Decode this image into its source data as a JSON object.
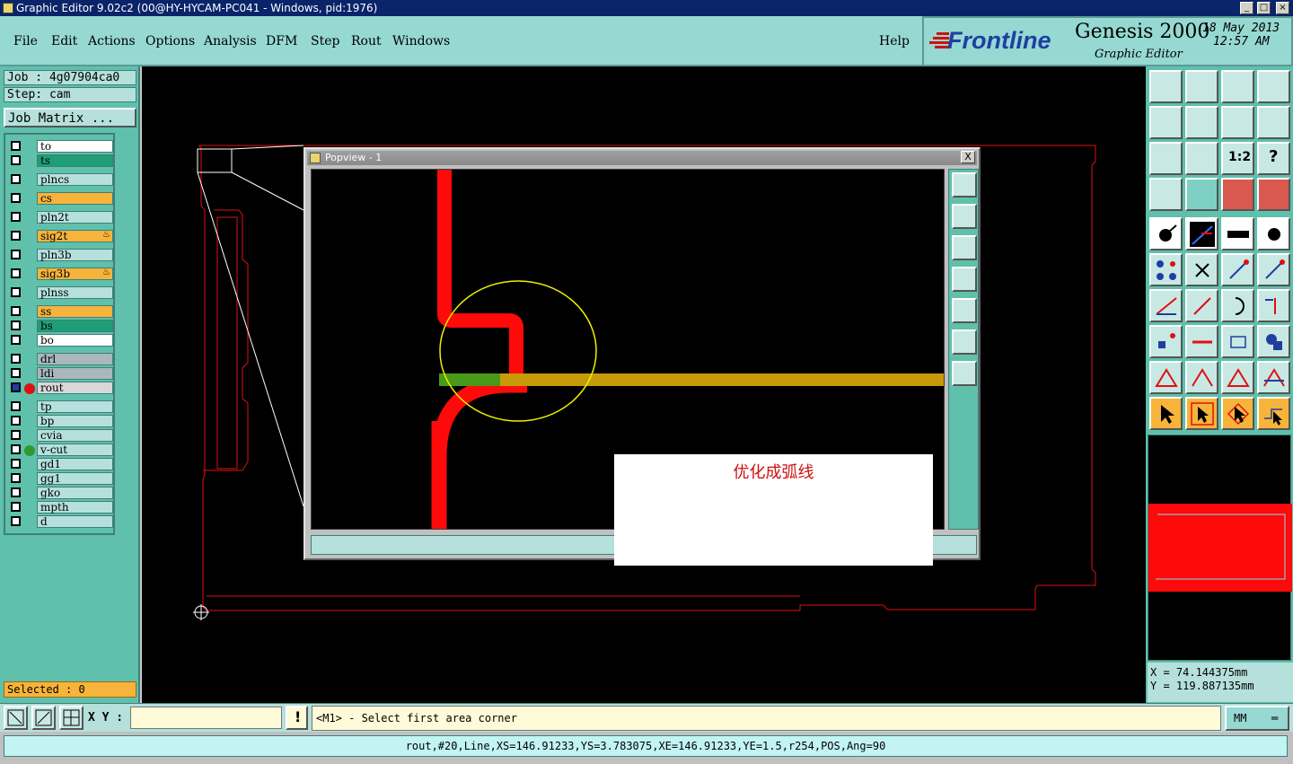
{
  "window": {
    "title": "Graphic Editor 9.02c2 (00@HY-HYCAM-PC041 - Windows, pid:1976)"
  },
  "menu": {
    "items": [
      {
        "label": "File"
      },
      {
        "label": "Edit"
      },
      {
        "label": "Actions"
      },
      {
        "label": "Options"
      },
      {
        "label": "Analysis"
      },
      {
        "label": "DFM"
      },
      {
        "label": "Step"
      },
      {
        "label": "Rout"
      },
      {
        "label": "Windows"
      }
    ],
    "help": "Help"
  },
  "branding": {
    "logo": "Frontline",
    "product": "Genesis 2000",
    "subtitle": "Graphic Editor",
    "date": "18 May 2013",
    "time": "12:57 AM"
  },
  "job": {
    "job_label": "Job : 4g07904ca0",
    "step_label": "Step: cam",
    "matrix_button": "Job Matrix ..."
  },
  "layers": [
    {
      "name": "to",
      "color": "#ffffff"
    },
    {
      "name": "ts",
      "color": "#1f9e75"
    },
    {
      "name": "plncs",
      "color": "#b5e0dc"
    },
    {
      "name": "cs",
      "color": "#f7b43a"
    },
    {
      "name": "pln2t",
      "color": "#b5e0dc"
    },
    {
      "name": "sig2t",
      "color": "#f7b43a"
    },
    {
      "name": "pln3b",
      "color": "#b5e0dc"
    },
    {
      "name": "sig3b",
      "color": "#f7b43a"
    },
    {
      "name": "plnss",
      "color": "#b5e0dc"
    },
    {
      "name": "ss",
      "color": "#f7b43a"
    },
    {
      "name": "bs",
      "color": "#1f9e75"
    },
    {
      "name": "bo",
      "color": "#ffffff"
    },
    {
      "name": "drl",
      "color": "#a8b8bc"
    },
    {
      "name": "ldi",
      "color": "#a8b8bc"
    },
    {
      "name": "rout",
      "color": "#d8d8d8"
    },
    {
      "name": "tp",
      "color": "#b5e0dc"
    },
    {
      "name": "bp",
      "color": "#b5e0dc"
    },
    {
      "name": "cvia",
      "color": "#b5e0dc"
    },
    {
      "name": "v-cut",
      "color": "#b5e0dc"
    },
    {
      "name": "gd1",
      "color": "#b5e0dc"
    },
    {
      "name": "gg1",
      "color": "#b5e0dc"
    },
    {
      "name": "gko",
      "color": "#b5e0dc"
    },
    {
      "name": "mpth",
      "color": "#b5e0dc"
    },
    {
      "name": "d",
      "color": "#b5e0dc"
    }
  ],
  "selected_label": "Selected : 0",
  "popview": {
    "title": "Popview - 1",
    "close": "X"
  },
  "annotation": {
    "text": "优化成弧线"
  },
  "coords": {
    "x": "X =  74.144375mm",
    "y": "Y = 119.887135mm"
  },
  "input": {
    "xy_label": "X Y :",
    "xy_value": "",
    "prompt": "<M1> - Select first area corner",
    "units": "MM"
  },
  "status": {
    "text": "rout,#20,Line,XS=146.91233,YS=3.783075,XE=146.91233,YE=1.5,r254,POS,Ang=90"
  },
  "colors": {
    "panel": "#5fc0ab",
    "menubar": "#96d8d2",
    "canvas": "#000000",
    "accent": "#f7b43a"
  }
}
